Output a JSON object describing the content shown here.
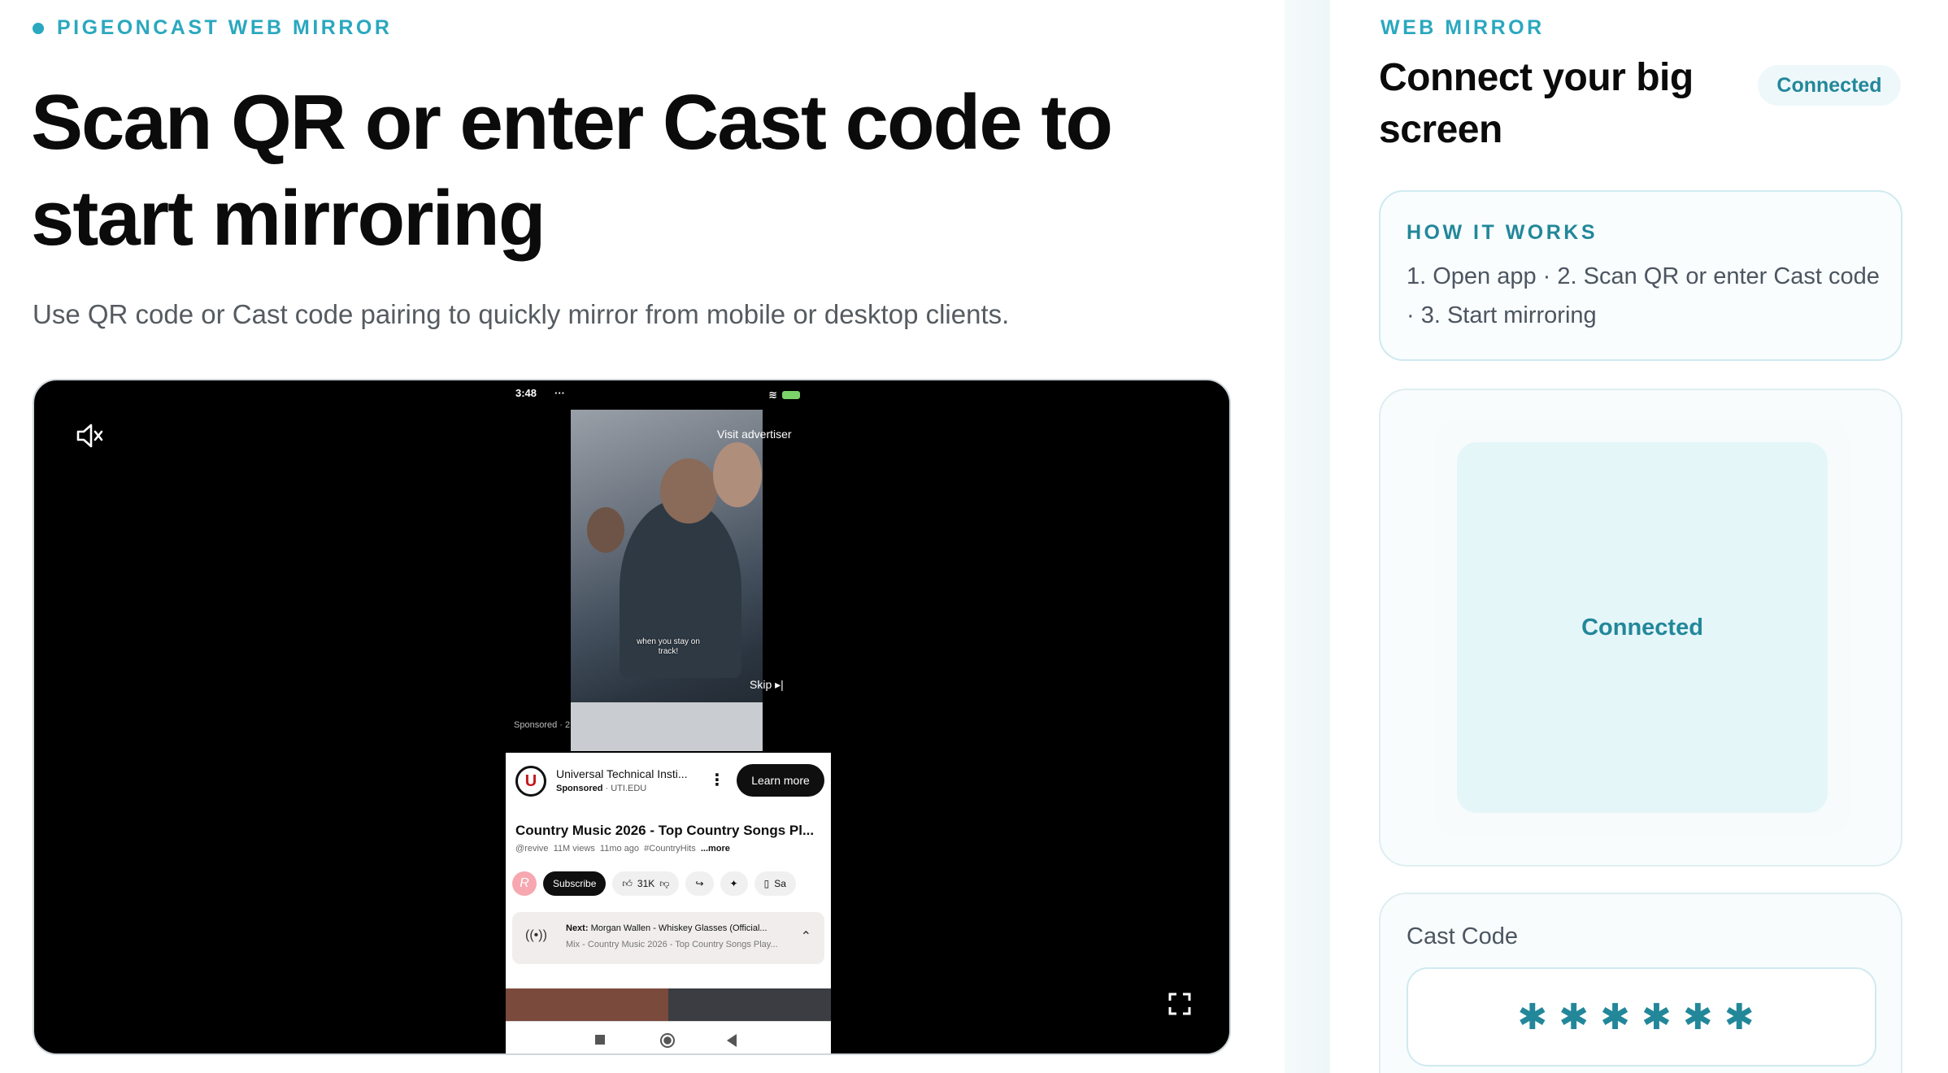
{
  "brand": {
    "label": "PIGEONCAST WEB MIRROR",
    "accent": "#2aa8bf"
  },
  "hero": {
    "title": "Scan QR or enter Cast code to start mirroring",
    "subtitle": "Use QR code or Cast code pairing to quickly mirror from mobile or desktop clients."
  },
  "player": {
    "mute_icon": "speaker-muted-icon",
    "fullscreen_icon": "fullscreen-icon",
    "phone": {
      "status_time": "3:48",
      "status_dots": "···",
      "visit_advertiser": "Visit advertiser",
      "caption": "when you stay on track!",
      "skip": "Skip ▸|",
      "sponsored_strip": "Sponsored · 2",
      "ad": {
        "logo_letter": "U",
        "title": "Universal Technical Insti...",
        "sponsored": "Sponsored",
        "domain": "· UTI.EDU",
        "menu": "⋮",
        "cta": "Learn more"
      },
      "video": {
        "title": "Country Music 2026 - Top Country Songs Pl...",
        "channel": "@revive",
        "views": "11M views",
        "age": "11mo ago",
        "hashtag": "#CountryHits",
        "more": "...more"
      },
      "actions": {
        "avatar_letter": "R",
        "subscribe": "Subscribe",
        "likes": "31K",
        "save": "Sa"
      },
      "next": {
        "prefix": "Next:",
        "title": "Morgan Wallen - Whiskey Glasses (Official...",
        "playlist": "Mix - Country Music 2026 - Top Country Songs Play..."
      }
    }
  },
  "sidebar": {
    "label": "WEB MIRROR",
    "title": "Connect your big screen",
    "status_badge": "Connected",
    "how": {
      "label": "HOW IT WORKS",
      "text": "1. Open app · 2. Scan QR or enter Cast code · 3. Start mirroring"
    },
    "qr": {
      "status": "Connected"
    },
    "cast": {
      "label": "Cast Code",
      "value": "✱✱✱✱✱✱"
    }
  }
}
